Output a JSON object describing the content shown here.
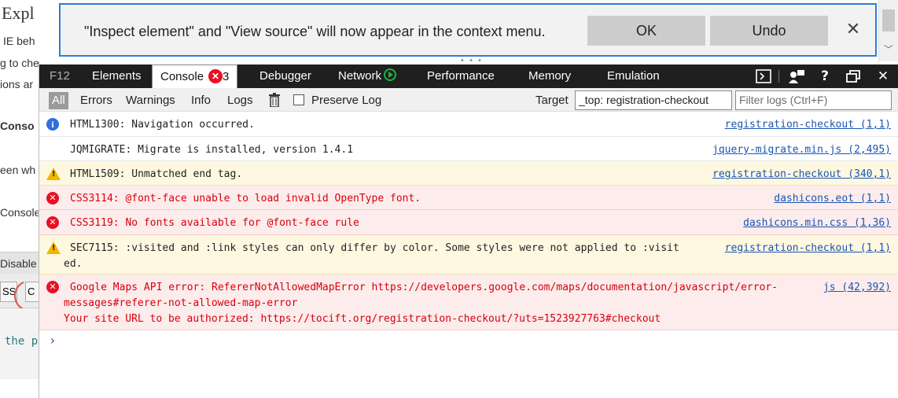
{
  "background_page": {
    "title": "Expl",
    "lines": [
      "IE beh",
      "g to che",
      "ions ar",
      "Conso",
      "een wh",
      "Console"
    ],
    "disable_label": "Disable",
    "tabs": [
      "SS",
      "C"
    ],
    "code_snippet": "the p"
  },
  "notification": {
    "message": "\"Inspect element\" and \"View source\" will now appear in the context menu.",
    "ok_label": "OK",
    "undo_label": "Undo",
    "close_icon": "close-icon",
    "border_color": "#2a7fd4"
  },
  "devtools": {
    "tabs": [
      {
        "label": "F12"
      },
      {
        "label": "Elements"
      },
      {
        "label": "Console",
        "error_count": "3",
        "active": true
      },
      {
        "label": "Debugger"
      },
      {
        "label": "Network"
      },
      {
        "label": "Performance"
      },
      {
        "label": "Memory"
      },
      {
        "label": "Emulation"
      }
    ],
    "toolbar_icons": [
      "console-prompt-icon",
      "feedback-icon",
      "help-icon",
      "undock-icon",
      "close-icon"
    ],
    "help_glyph": "?",
    "close_glyph": "✕",
    "filters": {
      "all": "All",
      "errors": "Errors",
      "warnings": "Warnings",
      "info": "Info",
      "logs": "Logs",
      "preserve_log": "Preserve Log",
      "target_label": "Target",
      "target_value": "_top: registration-checkout",
      "filter_placeholder": "Filter logs (Ctrl+F)"
    },
    "messages": [
      {
        "type": "info",
        "text": "HTML1300: Navigation occurred.",
        "source": "registration-checkout (1,1)"
      },
      {
        "type": "log",
        "text": "JQMIGRATE: Migrate is installed, version 1.4.1",
        "source": "jquery-migrate.min.js (2,495)"
      },
      {
        "type": "warn",
        "text": "HTML1509: Unmatched end tag.",
        "source": "registration-checkout (340,1)"
      },
      {
        "type": "err",
        "text": "CSS3114: @font-face unable to load invalid OpenType font.",
        "source": "dashicons.eot (1,1)"
      },
      {
        "type": "err",
        "text": "CSS3119: No fonts available for @font-face rule",
        "source": "dashicons.min.css (1,36)"
      },
      {
        "type": "warn",
        "text_line1": "SEC7115: :visited and :link styles can only differ by color. Some styles were not applied to :visit",
        "text_line2": "ed.",
        "source": "registration-checkout (1,1)"
      },
      {
        "type": "err",
        "text_line1": "Google Maps API error: RefererNotAllowedMapError https://developers.google.com/maps/documentation/javascript/error-",
        "text_line2": "messages#referer-not-allowed-map-error",
        "text_line3": "Your site URL to be authorized: https://tocift.org/registration-checkout/?uts=1523927763#checkout",
        "source": "js (42,392)"
      }
    ],
    "prompt_glyph": "›"
  }
}
